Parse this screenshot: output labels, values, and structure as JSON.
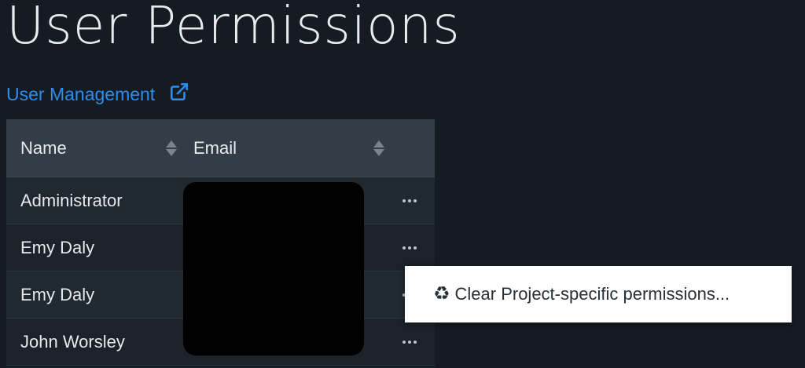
{
  "page": {
    "title": "User Permissions"
  },
  "user_management": {
    "label": "User Management",
    "icon": "external-link-icon"
  },
  "table": {
    "columns": [
      {
        "label": "Name",
        "sortable": true
      },
      {
        "label": "Email",
        "sortable": true
      }
    ],
    "rows": [
      {
        "name": "Administrator"
      },
      {
        "name": "Emy Daly"
      },
      {
        "name": "Emy Daly"
      },
      {
        "name": "John Worsley"
      }
    ],
    "actions_icon": "more-horizontal-icon"
  },
  "context_menu": {
    "items": [
      {
        "label": "Clear Project-specific permissions...",
        "icon": "recycle-icon"
      }
    ]
  },
  "colors": {
    "background": "#151b22",
    "link": "#2d8cf0",
    "header": "#333d47"
  }
}
